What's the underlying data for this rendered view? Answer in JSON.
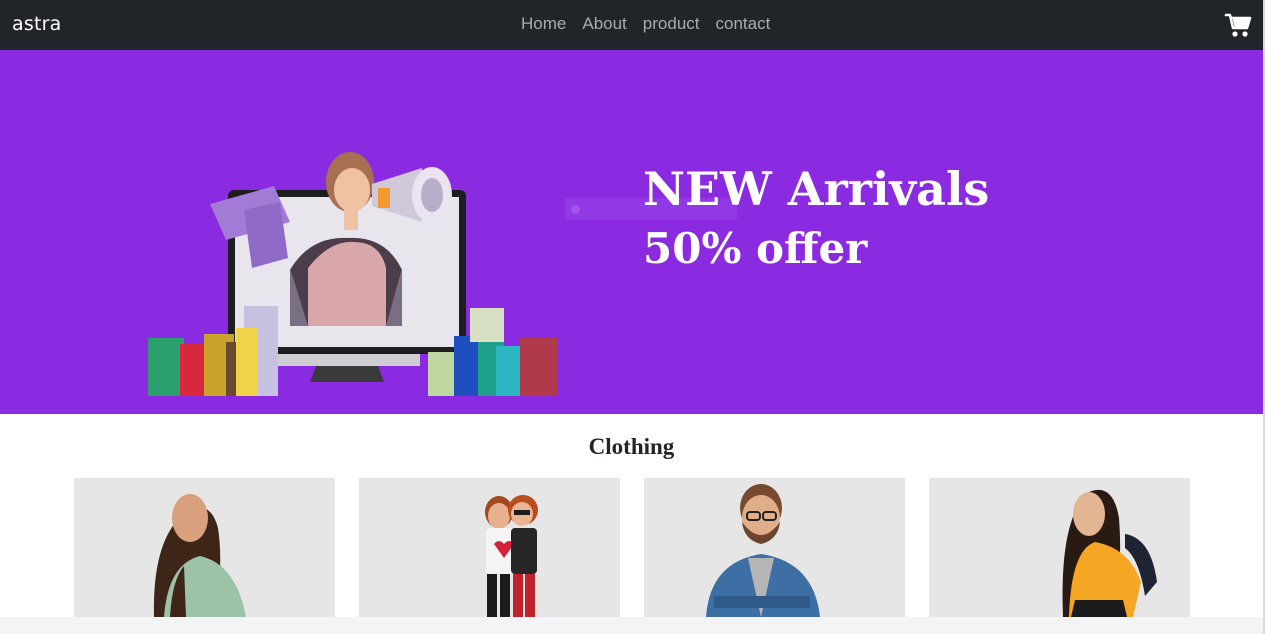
{
  "navbar": {
    "brand": "astra",
    "links": [
      "Home",
      "About",
      "product",
      "contact"
    ],
    "cart_icon": "shopping-cart-icon"
  },
  "hero": {
    "title": "NEW Arrivals",
    "offer": "50% offer",
    "background": "#8a2be2"
  },
  "clothing": {
    "heading": "Clothing",
    "cards": [
      {
        "image": "woman-green-sweater-photo"
      },
      {
        "image": "kids-couple-photo"
      },
      {
        "image": "man-plaid-shirt-photo"
      },
      {
        "image": "woman-yellow-tshirt-photo"
      }
    ]
  },
  "colors": {
    "navbar": "#212529",
    "hero_bg": "#8a2be2",
    "card_bg": "#e6e6e6",
    "nav_link": "#a9abae"
  }
}
